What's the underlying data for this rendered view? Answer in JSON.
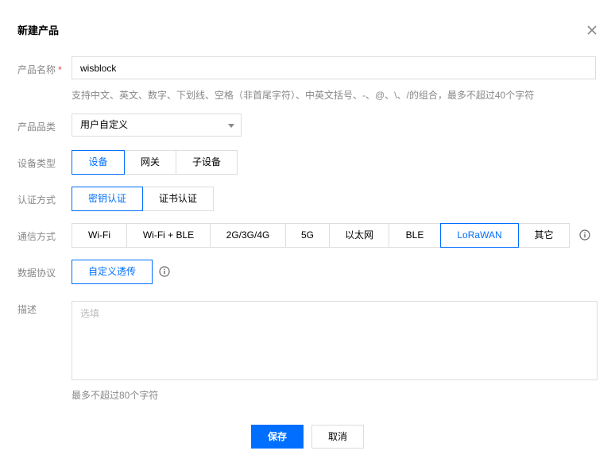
{
  "dialog": {
    "title": "新建产品"
  },
  "fields": {
    "product_name": {
      "label": "产品名称",
      "required_mark": "*",
      "value": "wisblock",
      "hint": "支持中文、英文、数字、下划线、空格（非首尾字符）、中英文括号、-、@、\\、/的组合，最多不超过40个字符"
    },
    "product_category": {
      "label": "产品品类",
      "selected": "用户自定义"
    },
    "device_type": {
      "label": "设备类型",
      "options": [
        "设备",
        "网关",
        "子设备"
      ],
      "selected_index": 0
    },
    "auth_method": {
      "label": "认证方式",
      "options": [
        "密钥认证",
        "证书认证"
      ],
      "selected_index": 0
    },
    "comm_method": {
      "label": "通信方式",
      "options": [
        "Wi-Fi",
        "Wi-Fi + BLE",
        "2G/3G/4G",
        "5G",
        "以太网",
        "BLE",
        "LoRaWAN",
        "其它"
      ],
      "selected_index": 6
    },
    "data_protocol": {
      "label": "数据协议",
      "options": [
        "自定义透传"
      ],
      "selected_index": 0
    },
    "description": {
      "label": "描述",
      "placeholder": "选填",
      "hint": "最多不超过80个字符"
    }
  },
  "actions": {
    "save_label": "保存",
    "cancel_label": "取消"
  },
  "colors": {
    "accent": "#006eff",
    "required": "#e54545",
    "label": "#888888",
    "border": "#dddddd"
  }
}
